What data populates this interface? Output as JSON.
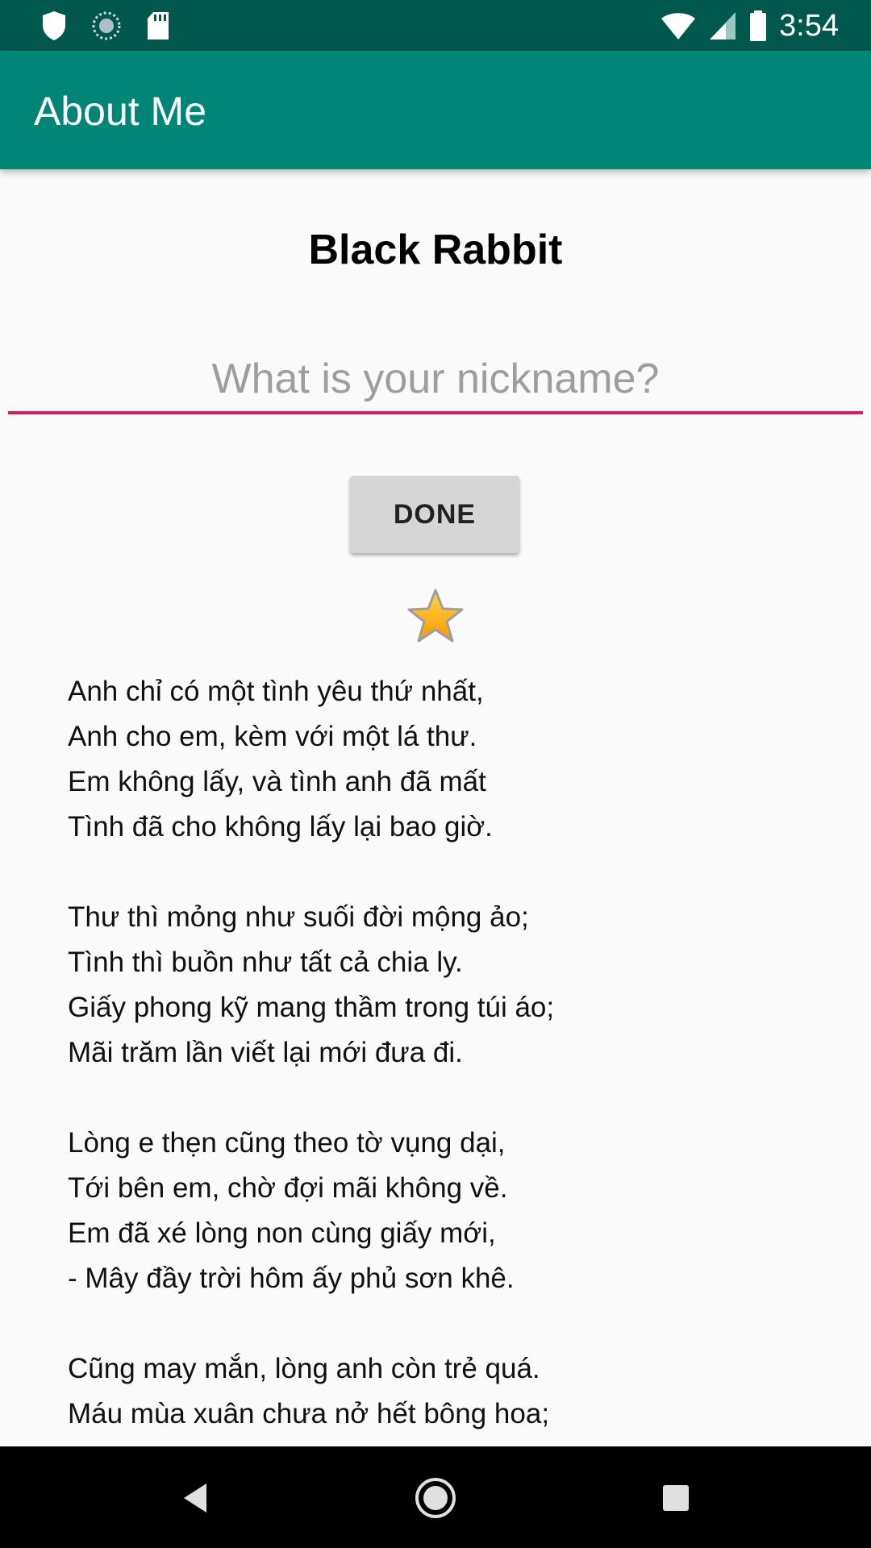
{
  "status_bar": {
    "time": "3:54",
    "left_icons": [
      "shield-icon",
      "sync-icon",
      "sd-card-icon"
    ],
    "right_icons": [
      "wifi-icon",
      "signal-icon",
      "battery-icon"
    ],
    "color": "#00574b"
  },
  "app_bar": {
    "title": "About Me",
    "color": "#008577"
  },
  "main": {
    "name": "Black Rabbit",
    "nickname_input": {
      "value": "",
      "placeholder": "What is your nickname?",
      "underline_color": "#d81b60"
    },
    "done_button_label": "DONE",
    "star_icon": "star-icon",
    "poem": {
      "stanzas": [
        [
          "Anh chỉ có một tình yêu thứ nhất,",
          "Anh cho em, kèm với một lá thư.",
          "Em không lấy, và tình anh đã mất",
          "Tình đã cho không lấy lại bao giờ."
        ],
        [
          "Thư thì mỏng như suối đời mộng ảo;",
          "Tình thì buồn như tất cả chia ly.",
          "Giấy phong kỹ mang thầm trong túi áo;",
          "Mãi trăm lần viết lại mới đưa đi."
        ],
        [
          "Lòng e thẹn cũng theo tờ vụng dại,",
          "Tới bên em, chờ đợi mãi không về.",
          "Em đã xé lòng non cùng giấy mới,",
          "- Mây đầy trời hôm ấy phủ sơn khê."
        ],
        [
          "Cũng may mắn, lòng anh còn trẻ quá.",
          "Máu mùa xuân chưa nở hết bông hoa;"
        ]
      ]
    }
  },
  "nav_bar": {
    "buttons": [
      "back-icon",
      "home-icon",
      "recents-icon"
    ]
  }
}
